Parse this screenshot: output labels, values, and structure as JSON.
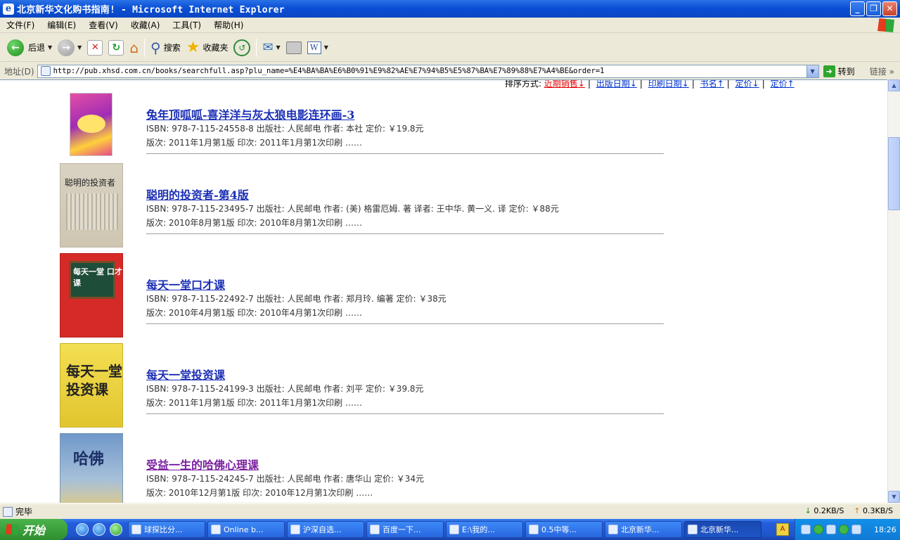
{
  "window": {
    "title": "北京新华文化购书指南! - Microsoft Internet Explorer"
  },
  "menu": [
    "文件(F)",
    "编辑(E)",
    "查看(V)",
    "收藏(A)",
    "工具(T)",
    "帮助(H)"
  ],
  "toolbar": {
    "back_label": "后退",
    "search_label": "搜索",
    "favorites_label": "收藏夹"
  },
  "address": {
    "label": "地址(D)",
    "url": "http://pub.xhsd.com.cn/books/searchfull.asp?plu_name=%E4%BA%BA%E6%B0%91%E9%82%AE%E7%94%B5%E5%87%BA%E7%89%88%E7%A4%BE&order=1",
    "go_label": "转到",
    "links_label": "链接"
  },
  "sort": {
    "label": "排序方式:",
    "options": [
      "近期销售↓",
      "出版日期↓",
      "印刷日期↓",
      "书名↑",
      "定价↓",
      "定价↑"
    ]
  },
  "books": [
    {
      "title": "兔年顶呱呱-喜洋洋与灰太狼电影连环画-3",
      "line1": "ISBN: 978-7-115-24558-8    出版社: 人民邮电    作者: 本社        定价: ￥19.8元",
      "line2": "版次: 2011年1月第1版  印次: 2011年1月第1次印刷    ……"
    },
    {
      "title": "聪明的投资者-第4版",
      "line1": "ISBN: 978-7-115-23495-7    出版社: 人民邮电    作者: (美) 格雷厄姆. 著     译者: 王中华. 黄一义. 译     定价: ￥88元",
      "line2": "版次: 2010年8月第1版  印次: 2010年8月第1次印刷    ……",
      "cover_text": "聪明的投资者"
    },
    {
      "title": "每天一堂口才课",
      "line1": "ISBN: 978-7-115-22492-7    出版社: 人民邮电    作者: 郑月玲. 编著       定价: ￥38元",
      "line2": "版次: 2010年4月第1版  印次: 2010年4月第1次印刷    ……",
      "cover_text": "每天一堂 口才课"
    },
    {
      "title": "每天一堂投资课",
      "line1": "ISBN: 978-7-115-24199-3    出版社: 人民邮电    作者: 刘平        定价: ￥39.8元",
      "line2": "版次: 2011年1月第1版  印次: 2011年1月第1次印刷    ……",
      "cover_text": "每天一堂 投资课"
    },
    {
      "title": "受益一生的哈佛心理课",
      "line1": "ISBN: 978-7-115-24245-7    出版社: 人民邮电    作者: 唐华山        定价: ￥34元",
      "line2": "版次: 2010年12月第1版  印次: 2010年12月第1次印刷    ……",
      "cover_text": "哈佛"
    }
  ],
  "status": {
    "text": "完毕",
    "down_speed": "0.2KB/S",
    "up_speed": "0.3KB/S"
  },
  "taskbar": {
    "start_label": "开始",
    "tasks": [
      "球探比分...",
      "Online b...",
      "沪深自选...",
      "百度一下...",
      "E:\\我的...",
      "0.5中等...",
      "北京新华...",
      "北京新华..."
    ],
    "clock": "18:26"
  },
  "colors": {
    "link": "#1b2fb5",
    "visited_link": "#7a1fa0",
    "sort_active": "#e60000"
  }
}
